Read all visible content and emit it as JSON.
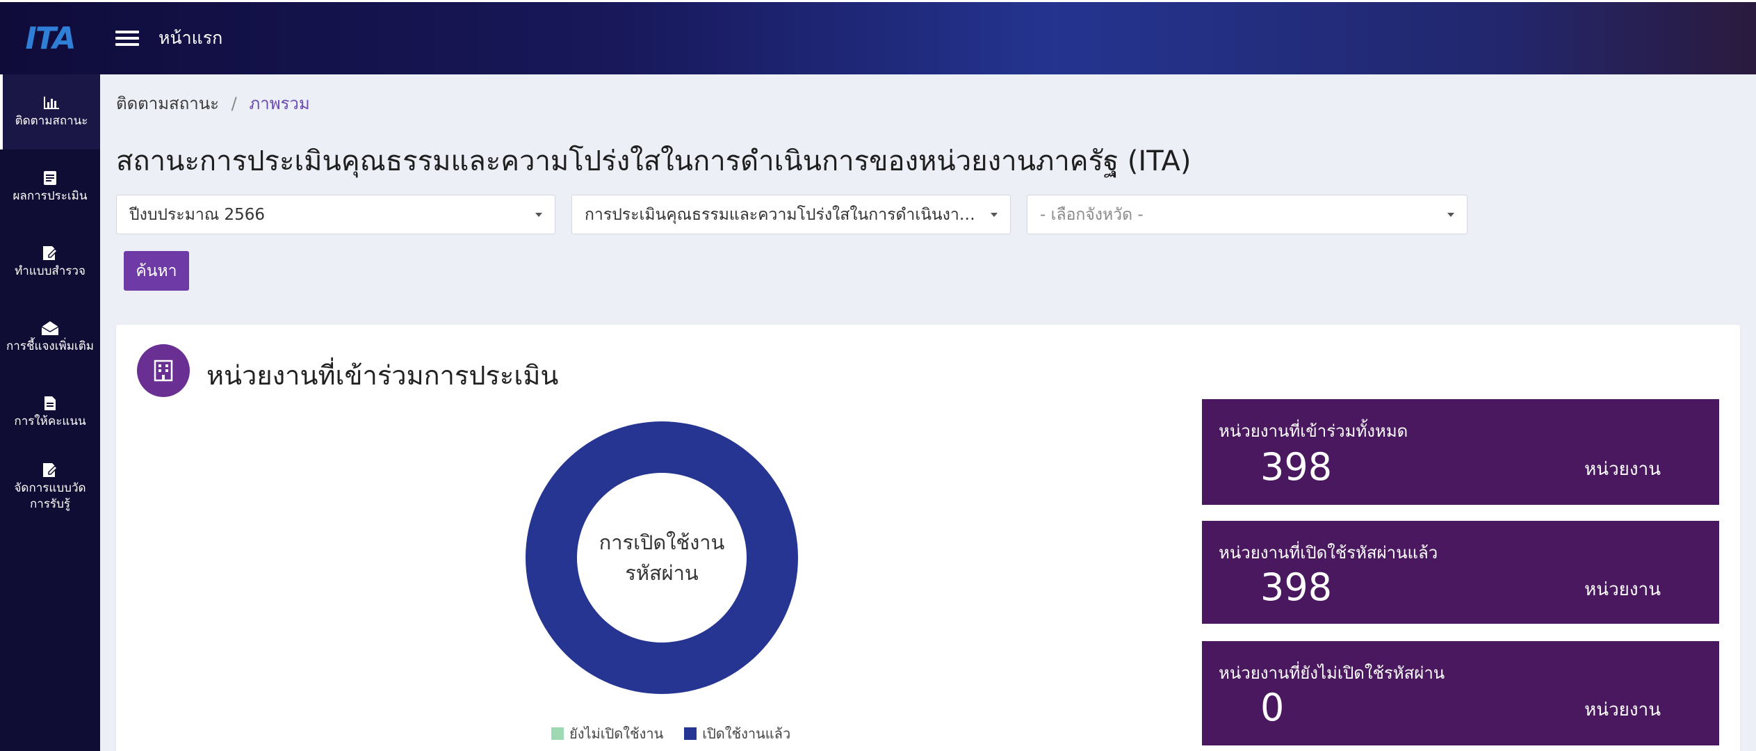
{
  "header": {
    "logo_text": "ITA",
    "home_label": "หน้าแรก"
  },
  "sidebar": {
    "items": [
      {
        "label": "ติดตามสถานะ",
        "icon": "bar-chart-icon",
        "active": true
      },
      {
        "label": "ผลการประเมิน",
        "icon": "document-list-icon"
      },
      {
        "label": "ทำแบบสำรวจ",
        "icon": "edit-form-icon"
      },
      {
        "label": "การชี้แจงเพิ่มเติม",
        "icon": "envelope-open-icon"
      },
      {
        "label": "การให้คะแนน",
        "icon": "file-icon"
      },
      {
        "label": "จัดการแบบวัดการรับรู้",
        "icon": "edit-form-icon"
      }
    ]
  },
  "breadcrumb": {
    "parent": "ติดตามสถานะ",
    "separator": "/",
    "current": "ภาพรวม"
  },
  "page_title": "สถานะการประเมินคุณธรรมและความโปร่งใสในการดำเนินการของหน่วยงานภาครัฐ (ITA)",
  "filters": {
    "year": "ปีงบประมาณ 2566",
    "assessment": "การประเมินคุณธรรมและความโปร่งใสในการดำเนินงานข...",
    "province_placeholder": "- เลือกจังหวัด -"
  },
  "search_button": "ค้นหา",
  "card": {
    "title": "หน่วยงานที่เข้าร่วมการประเมิน",
    "icon": "building-icon",
    "donut_center_line1": "การเปิดใช้งาน",
    "donut_center_line2": "รหัสผ่าน",
    "colors": {
      "not_activated": "#9fd9b4",
      "activated": "#263592",
      "stat_bg": "#4a185f",
      "accent": "#6e3aa5"
    }
  },
  "chart_data": {
    "type": "pie",
    "categories": [
      "ยังไม่เปิดใช้งาน",
      "เปิดใช้งานแล้ว"
    ],
    "values": [
      0,
      398
    ],
    "colors": [
      "#9fd9b4",
      "#263592"
    ],
    "donut": true,
    "legend_position": "bottom"
  },
  "stats": [
    {
      "label": "หน่วยงานที่เข้าร่วมทั้งหมด",
      "value": "398",
      "unit": "หน่วยงาน"
    },
    {
      "label": "หน่วยงานที่เปิดใช้รหัสผ่านแล้ว",
      "value": "398",
      "unit": "หน่วยงาน"
    },
    {
      "label": "หน่วยงานที่ยังไม่เปิดใช้รหัสผ่าน",
      "value": "0",
      "unit": "หน่วยงาน"
    }
  ]
}
